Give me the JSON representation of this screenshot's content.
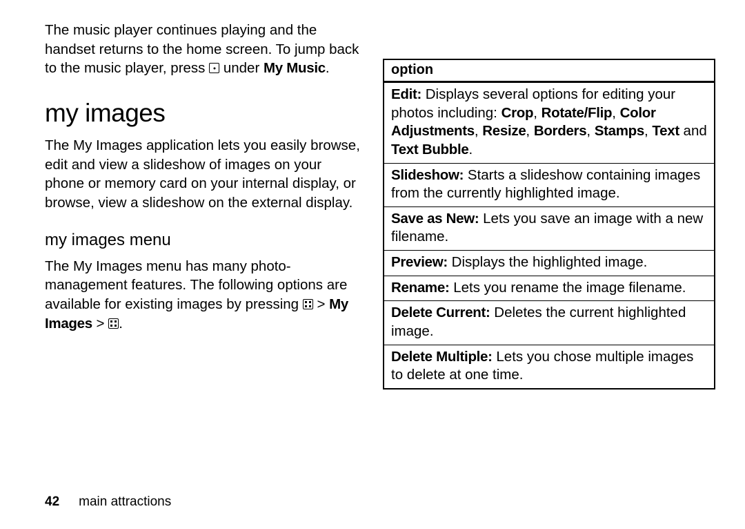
{
  "intro": {
    "text_before": "The music player continues playing and the handset returns to the home screen. To jump back to the music player, press ",
    "text_mid": " under ",
    "bold1": "My Music",
    "period": "."
  },
  "section_title": "my images",
  "desc": "The My Images application lets you easily browse, edit and view a slideshow of images on your phone or memory card on your internal display, or browse, view a slideshow on the external display.",
  "sub_title": "my images menu",
  "menu_para": {
    "text1": "The My Images menu has many photo-management features. The following options are available for existing images by pressing ",
    "sep1": " > ",
    "bold_mid": "My Images",
    "sep2": " > ",
    "period": "."
  },
  "table": {
    "header": "option",
    "rows": [
      {
        "bold1": "Edit:",
        "t1": " Displays several options for editing your photos including: ",
        "bold2": "Crop",
        "t2": ", ",
        "bold3": "Rotate/Flip",
        "t3": ", ",
        "bold4": "Color Adjustments",
        "t4": ", ",
        "bold5": "Resize",
        "t5": ", ",
        "bold6": "Borders",
        "t6": ", ",
        "bold7": "Stamps",
        "t7": ", ",
        "bold8": "Text",
        "t8": " and ",
        "bold9": "Text Bubble",
        "t9": "."
      },
      {
        "bold1": "Slideshow:",
        "t1": " Starts a slideshow containing images from the currently highlighted image."
      },
      {
        "bold1": "Save as New:",
        "t1": " Lets you save an image with a new filename."
      },
      {
        "bold1": "Preview:",
        "t1": " Displays the highlighted image."
      },
      {
        "bold1": "Rename:",
        "t1": " Lets you rename the image filename."
      },
      {
        "bold1": "Delete Current:",
        "t1": " Deletes the current highlighted image."
      },
      {
        "bold1": "Delete Multiple:",
        "t1": " Lets you chose multiple images to delete at one time."
      }
    ]
  },
  "footer": {
    "page": "42",
    "label": "main attractions"
  }
}
